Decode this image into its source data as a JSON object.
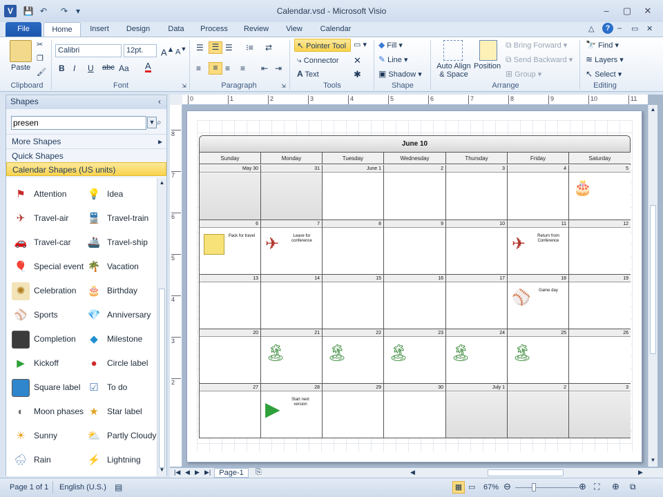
{
  "window": {
    "title": "Calendar.vsd - Microsoft Visio"
  },
  "tabs": [
    "File",
    "Home",
    "Insert",
    "Design",
    "Data",
    "Process",
    "Review",
    "View",
    "Calendar"
  ],
  "ribbon": {
    "clipboard": {
      "paste": "Paste",
      "label": "Clipboard"
    },
    "font": {
      "family": "Calibri",
      "size": "12pt.",
      "label": "Font",
      "bold": "B",
      "italic": "I",
      "underline": "U",
      "strike": "abc",
      "case": "Aa"
    },
    "paragraph": {
      "label": "Paragraph"
    },
    "tools": {
      "pointer": "Pointer Tool",
      "connector": "Connector",
      "text": "Text",
      "label": "Tools"
    },
    "shape": {
      "fill": "Fill",
      "line": "Line",
      "shadow": "Shadow",
      "label": "Shape"
    },
    "arrange": {
      "auto_align": "Auto Align & Space",
      "position": "Position",
      "bring_forward": "Bring Forward",
      "send_backward": "Send Backward",
      "group": "Group",
      "label": "Arrange"
    },
    "editing": {
      "find": "Find",
      "layers": "Layers",
      "select": "Select",
      "label": "Editing"
    }
  },
  "shapes_panel": {
    "title": "Shapes",
    "search_value": "presen",
    "more_shapes": "More Shapes",
    "quick_shapes": "Quick Shapes",
    "selected_stencil": "Calendar Shapes (US units)",
    "items": [
      {
        "label": "Attention",
        "icon": "flag-icon"
      },
      {
        "label": "Idea",
        "icon": "lightbulb-icon"
      },
      {
        "label": "Travel-air",
        "icon": "airplane-icon"
      },
      {
        "label": "Travel-train",
        "icon": "train-icon"
      },
      {
        "label": "Travel-car",
        "icon": "car-icon"
      },
      {
        "label": "Travel-ship",
        "icon": "ship-icon"
      },
      {
        "label": "Special event",
        "icon": "balloons-icon"
      },
      {
        "label": "Vacation",
        "icon": "palm-tree-icon"
      },
      {
        "label": "Celebration",
        "icon": "confetti-icon"
      },
      {
        "label": "Birthday",
        "icon": "cake-icon"
      },
      {
        "label": "Sports",
        "icon": "sports-icon"
      },
      {
        "label": "Anniversary",
        "icon": "diamond-icon"
      },
      {
        "label": "Completion",
        "icon": "completion-icon"
      },
      {
        "label": "Milestone",
        "icon": "milestone-icon"
      },
      {
        "label": "Kickoff",
        "icon": "kickoff-icon"
      },
      {
        "label": "Circle label",
        "icon": "circle-label-icon"
      },
      {
        "label": "Square label",
        "icon": "square-label-icon"
      },
      {
        "label": "To do",
        "icon": "todo-icon"
      },
      {
        "label": "Moon phases",
        "icon": "moon-icon"
      },
      {
        "label": "Star label",
        "icon": "star-icon"
      },
      {
        "label": "Sunny",
        "icon": "sun-icon"
      },
      {
        "label": "Partly Cloudy",
        "icon": "partly-cloudy-icon"
      },
      {
        "label": "Rain",
        "icon": "rain-icon"
      },
      {
        "label": "Lightning",
        "icon": "lightning-icon"
      }
    ]
  },
  "calendar": {
    "title": "June 10",
    "days": [
      "Sunday",
      "Monday",
      "Tuesday",
      "Wednesday",
      "Thursday",
      "Friday",
      "Saturday"
    ],
    "weeks": [
      [
        "May 30",
        "31",
        "June 1",
        "2",
        "3",
        "4",
        "5"
      ],
      [
        "6",
        "7",
        "8",
        "9",
        "10",
        "11",
        "12"
      ],
      [
        "13",
        "14",
        "15",
        "16",
        "17",
        "18",
        "19"
      ],
      [
        "20",
        "21",
        "22",
        "23",
        "24",
        "25",
        "26"
      ],
      [
        "27",
        "28",
        "29",
        "30",
        "July 1",
        "2",
        "3"
      ]
    ],
    "events": {
      "pack": "Pack for travel",
      "leave": "Leave for conference",
      "return": "Return from Conference",
      "game": "Game day",
      "start": "Start next version"
    }
  },
  "ruler": {
    "h": [
      "0",
      "1",
      "2",
      "3",
      "4",
      "5",
      "6",
      "7",
      "8",
      "9",
      "10",
      "11"
    ],
    "v": [
      "8",
      "7",
      "6",
      "5",
      "4",
      "3",
      "2"
    ]
  },
  "status": {
    "page": "Page 1 of 1",
    "language": "English (U.S.)",
    "page_tab": "Page-1",
    "zoom": "67%"
  }
}
